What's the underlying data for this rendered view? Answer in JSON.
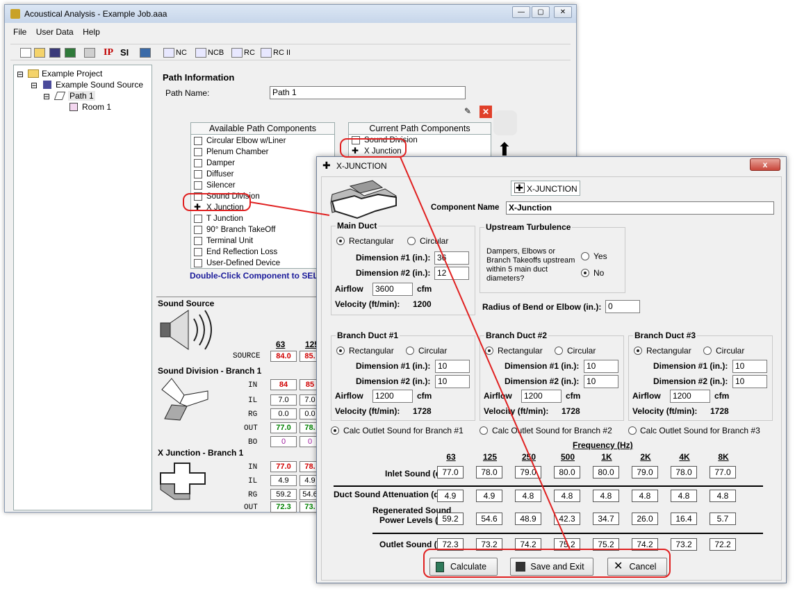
{
  "main_window": {
    "title": "Acoustical Analysis - Example Job.aaa",
    "menu": [
      "File",
      "User Data",
      "Help"
    ],
    "toolbar": {
      "ip": "IP",
      "si": "SI",
      "nc": "NC",
      "ncb": "NCB",
      "rc": "RC",
      "rc2": "RC II"
    },
    "tree": [
      "Example Project",
      "Example Sound Source",
      "Path 1",
      "Room 1"
    ],
    "path_info": {
      "title": "Path Information",
      "path_name_label": "Path Name:",
      "path_name_value": "Path 1",
      "available_header": "Available Path Components",
      "current_header": "Current Path Components",
      "available": [
        "Circular Elbow w/Liner",
        "Plenum Chamber",
        "Damper",
        "Diffuser",
        "Silencer",
        "Sound Division",
        "X Junction",
        "T Junction",
        "90° Branch TakeOff",
        "Terminal Unit",
        "End Reflection Loss",
        "User-Defined Device"
      ],
      "current": [
        "Sound Division",
        "X Junction"
      ],
      "hint": "Double-Click Component to SEL"
    },
    "sound_source": {
      "title": "Sound Source",
      "freq_headers": [
        "63",
        "125"
      ],
      "source_label": "SOURCE",
      "source_values": [
        "84.0",
        "85."
      ]
    },
    "sound_division": {
      "title": "Sound Division - Branch 1",
      "rows": [
        {
          "label": "IN",
          "v1": "84",
          "v2": "85"
        },
        {
          "label": "IL",
          "v1": "7.0",
          "v2": "7.0"
        },
        {
          "label": "RG",
          "v1": "0.0",
          "v2": "0.0"
        },
        {
          "label": "OUT",
          "v1": "77.0",
          "v2": "78."
        },
        {
          "label": "BO",
          "v1": "0",
          "v2": "0"
        }
      ]
    },
    "x_junction": {
      "title": "X Junction - Branch 1",
      "rows": [
        {
          "label": "IN",
          "v1": "77.0",
          "v2": "78."
        },
        {
          "label": "IL",
          "v1": "4.9",
          "v2": "4.9"
        },
        {
          "label": "RG",
          "v1": "59.2",
          "v2": "54.6"
        },
        {
          "label": "OUT",
          "v1": "72.3",
          "v2": "73."
        }
      ]
    }
  },
  "dialog": {
    "title": "X-JUNCTION",
    "close": "x",
    "badge": "X-JUNCTION",
    "component_name_label": "Component Name",
    "component_name_value": "X-Junction",
    "main_duct": {
      "legend": "Main Duct",
      "rect": "Rectangular",
      "circ": "Circular",
      "dim1_label": "Dimension #1 (in.):",
      "dim1": "36",
      "dim2_label": "Dimension #2 (in.):",
      "dim2": "12",
      "airflow_label": "Airflow",
      "airflow": "3600",
      "airflow_unit": "cfm",
      "velocity_label": "Velocity (ft/min):",
      "velocity": "1200"
    },
    "upstream": {
      "legend": "Upstream Turbulence",
      "text": "Dampers, Elbows or Branch Takeoffs upstream within 5 main duct diameters?",
      "yes": "Yes",
      "no": "No"
    },
    "radius_label": "Radius of Bend or Elbow (in.):",
    "radius_value": "0",
    "branches": [
      {
        "legend": "Branch Duct #1",
        "rect": "Rectangular",
        "circ": "Circular",
        "dim1_label": "Dimension #1 (in.):",
        "dim1": "10",
        "dim2_label": "Dimension #2 (in.):",
        "dim2": "10",
        "airflow_label": "Airflow",
        "airflow": "1200",
        "unit": "cfm",
        "velocity_label": "Velocity (ft/min):",
        "velocity": "1728",
        "calc": "Calc Outlet Sound for Branch #1"
      },
      {
        "legend": "Branch Duct #2",
        "rect": "Rectangular",
        "circ": "Circular",
        "dim1_label": "Dimension #1 (in.):",
        "dim1": "10",
        "dim2_label": "Dimension #2 (in.):",
        "dim2": "10",
        "airflow_label": "Airflow",
        "airflow": "1200",
        "unit": "cfm",
        "velocity_label": "Velocity (ft/min):",
        "velocity": "1728",
        "calc": "Calc Outlet Sound for Branch #2"
      },
      {
        "legend": "Branch Duct #3",
        "rect": "Rectangular",
        "circ": "Circular",
        "dim1_label": "Dimension #1 (in.):",
        "dim1": "10",
        "dim2_label": "Dimension #2 (in.):",
        "dim2": "10",
        "airflow_label": "Airflow",
        "airflow": "1200",
        "unit": "cfm",
        "velocity_label": "Velocity (ft/min):",
        "velocity": "1728",
        "calc": "Calc Outlet Sound for Branch #3"
      }
    ],
    "frequency_label": "Frequency (Hz)",
    "frequencies": [
      "63",
      "125",
      "250",
      "500",
      "1K",
      "2K",
      "4K",
      "8K"
    ],
    "rows": {
      "inlet_label": "Inlet Sound (dB):",
      "inlet": [
        "77.0",
        "78.0",
        "79.0",
        "80.0",
        "80.0",
        "79.0",
        "78.0",
        "77.0"
      ],
      "atten_label": "Duct Sound Attenuation (dB):",
      "atten": [
        "4.9",
        "4.9",
        "4.8",
        "4.8",
        "4.8",
        "4.8",
        "4.8",
        "4.8"
      ],
      "regen_label1": "Regenerated Sound",
      "regen_label2": "Power Levels (dB):",
      "regen": [
        "59.2",
        "54.6",
        "48.9",
        "42.3",
        "34.7",
        "26.0",
        "16.4",
        "5.7"
      ],
      "outlet_label": "Outlet Sound (dB):",
      "outlet": [
        "72.3",
        "73.2",
        "74.2",
        "75.2",
        "75.2",
        "74.2",
        "73.2",
        "72.2"
      ]
    },
    "buttons": {
      "calculate": "Calculate",
      "save": "Save and Exit",
      "cancel": "Cancel"
    }
  },
  "colors": {
    "highlight": "#e02020",
    "in_value": "#d00000",
    "out_value": "#008000",
    "bo_value": "#a020a0"
  }
}
